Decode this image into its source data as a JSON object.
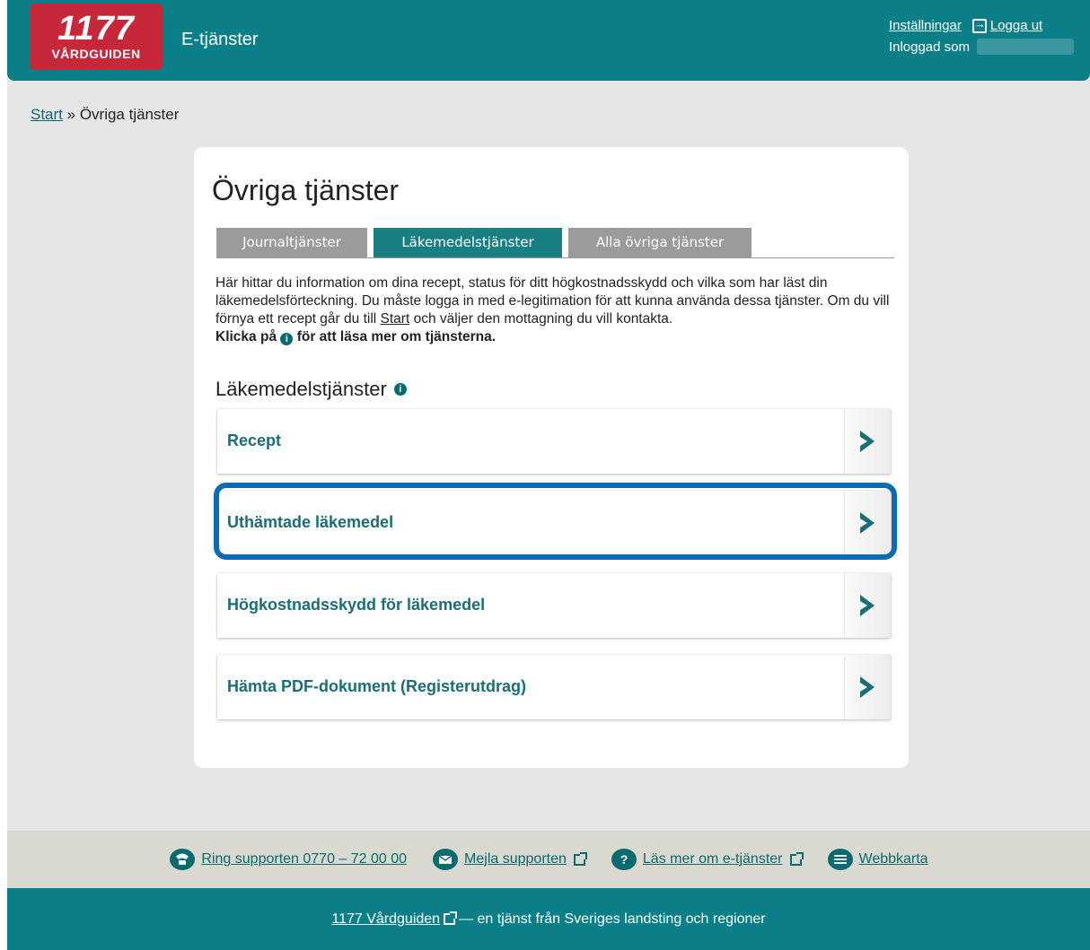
{
  "header": {
    "logo_number": "1177",
    "logo_word": "VÅRDGUIDEN",
    "app_title": "E-tjänster",
    "settings_link": "Inställningar",
    "logout_link": "Logga ut",
    "logged_in_as": "Inloggad som"
  },
  "breadcrumb": {
    "home": "Start",
    "separator": " » ",
    "current": "Övriga tjänster"
  },
  "page": {
    "title": "Övriga tjänster",
    "tabs": [
      {
        "label": "Journaltjänster",
        "active": false
      },
      {
        "label": "Läkemedelstjänster",
        "active": true
      },
      {
        "label": "Alla övriga tjänster",
        "active": false
      }
    ],
    "intro_text": "Här hittar du information om dina recept, status för ditt högkostnadsskydd och vilka som har läst din läkemedelsförteckning. Du måste logga in med e-legitimation för att kunna använda dessa tjänster. Om du vill förnya ett recept går du till",
    "intro_link": "Start",
    "intro_text_after": "och väljer den mottagning du vill kontakta.",
    "intro_bold_before": "Klicka på",
    "intro_bold_after": "för att läsa mer om tjänsterna.",
    "info_glyph": "i",
    "section_title": "Läkemedelstjänster",
    "services": [
      {
        "label": "Recept"
      },
      {
        "label": "Uthämtade läkemedel"
      },
      {
        "label": "Högkostnadsskydd för läkemedel"
      },
      {
        "label": "Hämta PDF-dokument (Registerutdrag)"
      }
    ]
  },
  "footer": {
    "links": [
      {
        "label": "Ring supporten 0770 – 72 00 00",
        "icon": "phone-icon"
      },
      {
        "label": "Mejla supporten",
        "icon": "mail-icon"
      },
      {
        "label": "Läs mer om e-tjänster",
        "icon": "question-icon"
      },
      {
        "label": "Webbkarta",
        "icon": "list-icon"
      }
    ],
    "bottom_link": "1177 Vårdguiden",
    "bottom_text": "— en tjänst från Sveriges landsting och regioner"
  },
  "colors": {
    "brand_teal": "#0b7f87",
    "logo_red": "#c6283a",
    "highlight_blue": "#0b6bb5"
  }
}
